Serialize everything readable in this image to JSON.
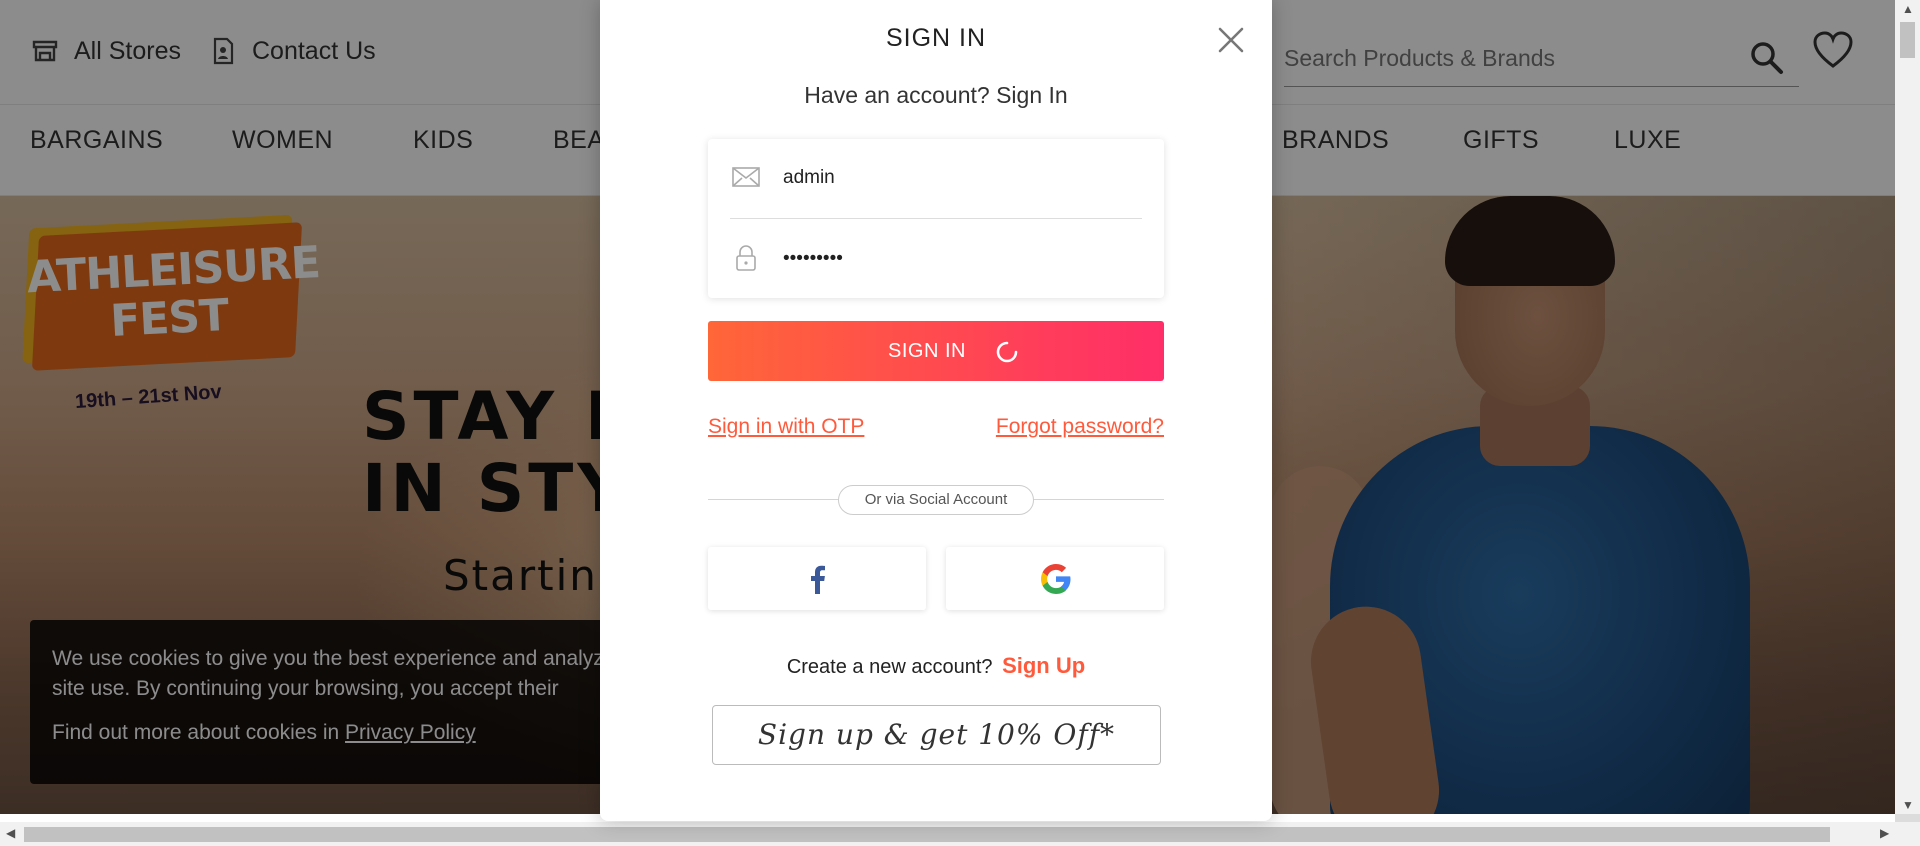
{
  "header": {
    "all_stores": "All Stores",
    "contact_us": "Contact Us",
    "search_placeholder": "Search Products & Brands"
  },
  "nav": {
    "items": [
      "BARGAINS",
      "WOMEN",
      "KIDS",
      "BEAUTY",
      "BRANDS",
      "GIFTS",
      "LUXE"
    ]
  },
  "hero": {
    "fest_line1": "ATHLEISURE",
    "fest_line2": "FEST",
    "fest_date": "19th – 21st Nov",
    "title_line1": "STAY FI",
    "title_line2": "IN STYL",
    "subtitle": "Starting"
  },
  "cookie": {
    "text": "We use cookies to give you the best experience and analyz the site use. By continuing your browsing, you accept their",
    "more_text": "Find out more about cookies in",
    "policy_link": "Privacy Policy"
  },
  "modal": {
    "title": "SIGN IN",
    "subtitle": "Have an account? Sign In",
    "username_value": "admin",
    "password_value": "•••••••••",
    "signin_button": "SIGN IN",
    "otp_link": "Sign in with OTP",
    "forgot_link": "Forgot password?",
    "or_text": "Or via Social Account",
    "create_text": "Create a new account?",
    "signup_link": "Sign Up",
    "promo_text": "Sign up & get 10% Off*"
  },
  "colors": {
    "accent": "#ff5a3c",
    "button_start": "#ff6638",
    "button_end": "#ff2e68",
    "facebook": "#3b5998"
  }
}
